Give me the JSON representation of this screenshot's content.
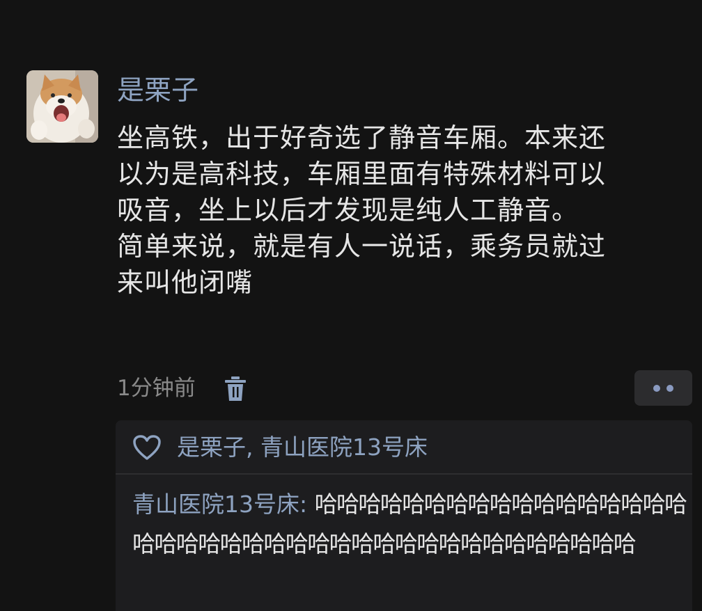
{
  "post": {
    "author": "是栗子",
    "avatar_icon": "shiba-dog-avatar-icon",
    "text_lines": [
      "坐高铁，出于好奇选了静音车厢。本来还",
      "以为是高科技，车厢里面有特殊材料可以",
      "吸音，坐上以后才发现是纯人工静音。",
      "简单来说，就是有人一说话，乘务员就过",
      "来叫他闭嘴"
    ],
    "timestamp": "1分钟前",
    "delete_icon": "trash-icon",
    "more_icon": "more-dots-icon"
  },
  "reply_section": {
    "like_icon": "heart-icon",
    "likes": "是栗子, 青山医院13号床",
    "comment": {
      "author": "青山医院13号床",
      "separator": ": ",
      "text": "哈哈哈哈哈哈哈哈哈哈哈哈哈哈哈哈哈哈哈哈哈哈哈哈哈哈哈哈哈哈哈哈哈哈哈哈哈哈哈哈"
    }
  },
  "colors": {
    "background": "#131313",
    "name_blue": "#8ea3c1",
    "text": "#e6e6e6",
    "muted": "#8a8a8a",
    "reply_bg": "#1d1d1f"
  }
}
